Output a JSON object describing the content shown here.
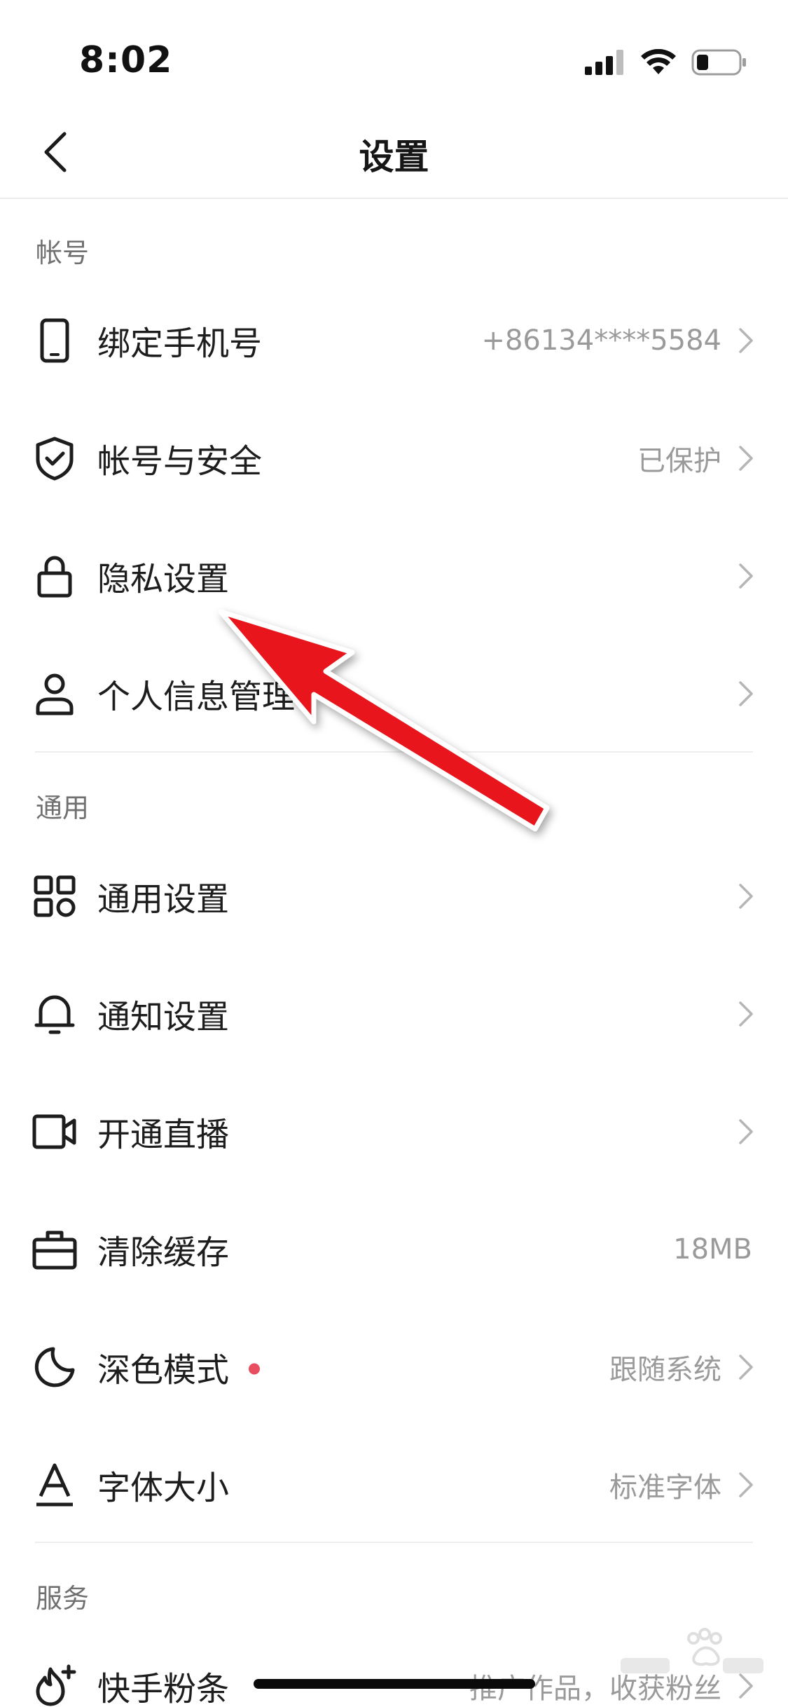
{
  "status_bar": {
    "time": "8:02"
  },
  "header": {
    "title": "设置"
  },
  "sections": [
    {
      "title": "帐号"
    },
    {
      "title": "通用"
    },
    {
      "title": "服务"
    }
  ],
  "account_items": [
    {
      "label": "绑定手机号",
      "value": "+86134****5584",
      "icon": "phone-icon"
    },
    {
      "label": "帐号与安全",
      "value": "已保护",
      "icon": "shield-check-icon"
    },
    {
      "label": "隐私设置",
      "value": "",
      "icon": "lock-icon"
    },
    {
      "label": "个人信息管理",
      "value": "",
      "icon": "user-icon"
    }
  ],
  "general_items": [
    {
      "label": "通用设置",
      "value": "",
      "icon": "grid-icon"
    },
    {
      "label": "通知设置",
      "value": "",
      "icon": "bell-icon"
    },
    {
      "label": "开通直播",
      "value": "",
      "icon": "video-camera-icon"
    },
    {
      "label": "清除缓存",
      "value": "18MB",
      "icon": "toolbox-icon"
    },
    {
      "label": "深色模式",
      "value": "跟随系统",
      "icon": "moon-icon"
    },
    {
      "label": "字体大小",
      "value": "标准字体",
      "icon": "font-a-icon"
    }
  ],
  "service_items": [
    {
      "label": "快手粉条",
      "value": "推广作品，收获粉丝",
      "icon": "flame-plus-icon"
    }
  ],
  "colors": {
    "accent_dot": "#e84d60",
    "annotation_arrow": "#e8151a",
    "secondary_text": "#9a9a9a",
    "section_text": "#707070"
  }
}
